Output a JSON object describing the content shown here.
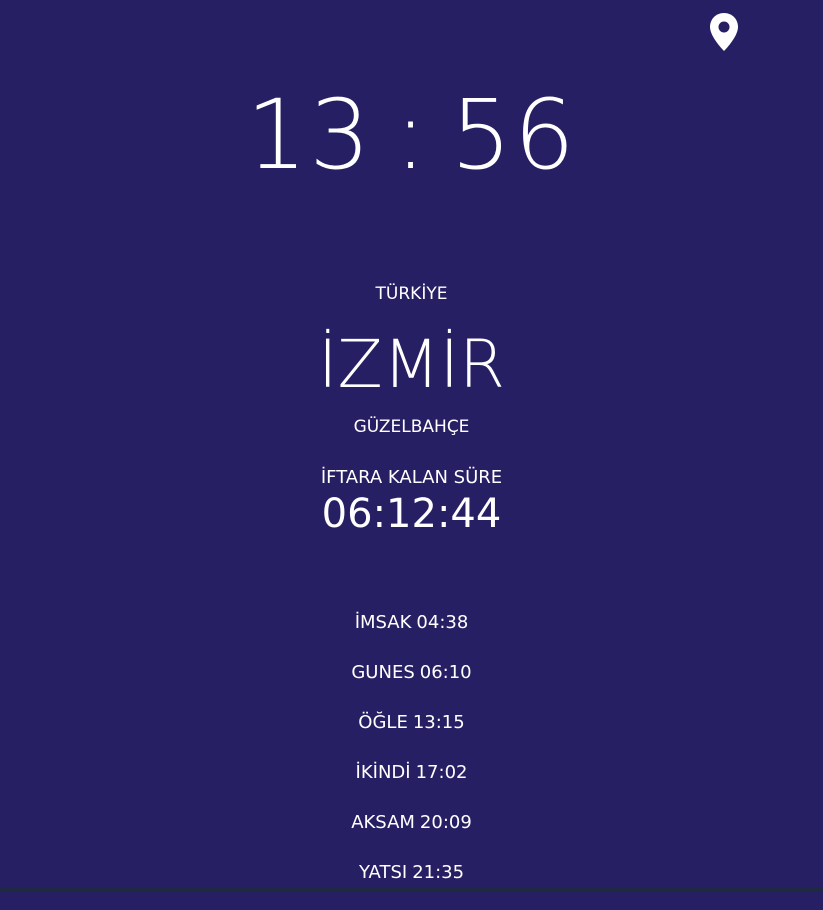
{
  "clock": {
    "hours": "13",
    "separator": ":",
    "minutes": "56"
  },
  "location": {
    "country": "TÜRKİYE",
    "city": "İZMİR",
    "district": "GÜZELBAHÇE",
    "icon": "map-pin-icon"
  },
  "countdown": {
    "label": "İFTARA KALAN SÜRE",
    "value": "06:12:44"
  },
  "prayers": [
    {
      "name": "İMSAK",
      "time": "04:38"
    },
    {
      "name": "GUNES",
      "time": "06:10"
    },
    {
      "name": "ÖĞLE",
      "time": "13:15"
    },
    {
      "name": "İKİNDİ",
      "time": "17:02"
    },
    {
      "name": "AKSAM",
      "time": "20:09"
    },
    {
      "name": "YATSI",
      "time": "21:35"
    }
  ],
  "colors": {
    "background": "#271f64",
    "text": "#ffffff"
  }
}
